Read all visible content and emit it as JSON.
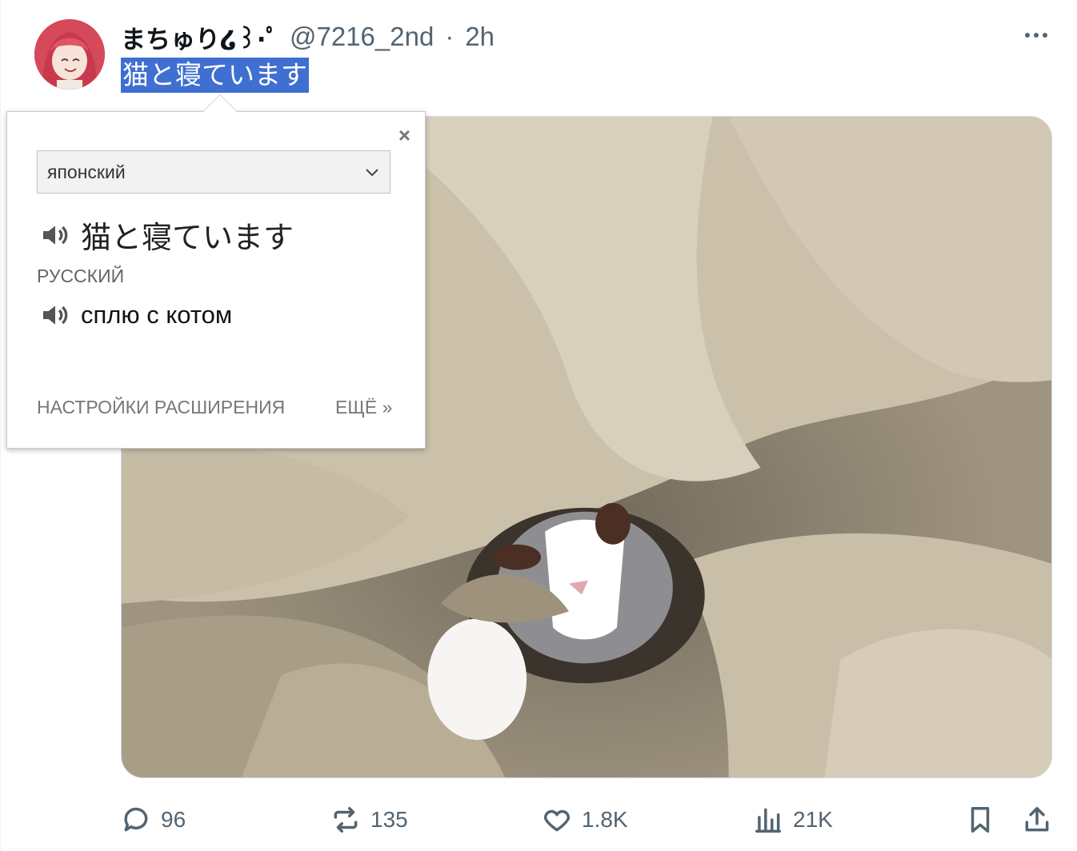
{
  "post": {
    "display_name": "まちゅり໒꒱·ﾟ",
    "handle": "@7216_2nd",
    "separator": "·",
    "time": "2h",
    "text": "猫と寝ています",
    "more_icon": "more-horizontal-icon"
  },
  "actions": {
    "reply_count": "96",
    "repost_count": "135",
    "like_count": "1.8K",
    "views_count": "21K"
  },
  "translator": {
    "source_lang": "японский",
    "source_text": "猫と寝ています",
    "target_lang": "РУССКИЙ",
    "target_text": "сплю с котом",
    "settings_link": "НАСТРОЙКИ РАСШИРЕНИЯ",
    "more_link": "ЕЩЁ »",
    "close_symbol": "×"
  },
  "colors": {
    "selection": "#3f6fd1",
    "muted_text": "#536471"
  }
}
